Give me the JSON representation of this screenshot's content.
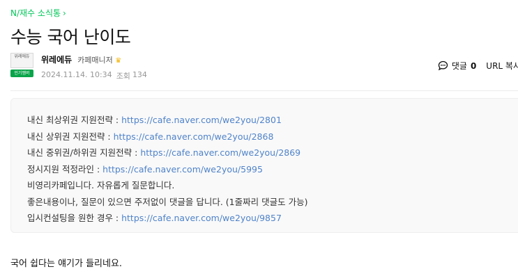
{
  "breadcrumb": {
    "board": "N/재수 소식통",
    "chevron": "›"
  },
  "post": {
    "title": "수능 국어 난이도"
  },
  "author": {
    "avatar_logo_text": "위레에듀",
    "avatar_badge": "인기멤버",
    "nickname": "위레에듀",
    "level": "카페매니저",
    "level_icon": "crown-icon",
    "date": "2024.11.14. 10:34",
    "views_label": "조회",
    "views": "134"
  },
  "tools": {
    "comment_label": "댓글",
    "comment_count": "0",
    "url_label": "URL 복사"
  },
  "notice": [
    {
      "text": "내신 최상위권 지원전략 : ",
      "link": "https://cafe.naver.com/we2you/2801"
    },
    {
      "text": "내신 상위권 지원전략 : ",
      "link": "https://cafe.naver.com/we2you/2868"
    },
    {
      "text": "내신 중위권/하위권 지원전략 : ",
      "link": "https://cafe.naver.com/we2you/2869"
    },
    {
      "text": "정시지원 적정라인 : ",
      "link": "https://cafe.naver.com/we2you/5995"
    },
    {
      "text": "비영리카페입니다. 자유롭게 질문합니다.",
      "link": ""
    },
    {
      "text": "좋은내용이나, 질문이 있으면 주저없이 댓글을 답니다. (1줄짜리 댓글도 가능)",
      "link": ""
    },
    {
      "text": "입시컨설팅을 원한 경우 : ",
      "link": "https://cafe.naver.com/we2you/9857"
    }
  ],
  "content": {
    "first_line": "국어 쉽다는 얘기가 들리네요."
  },
  "colors": {
    "accent": "#03c75a",
    "link": "#4f83c8",
    "badge": "#0aa44a"
  }
}
